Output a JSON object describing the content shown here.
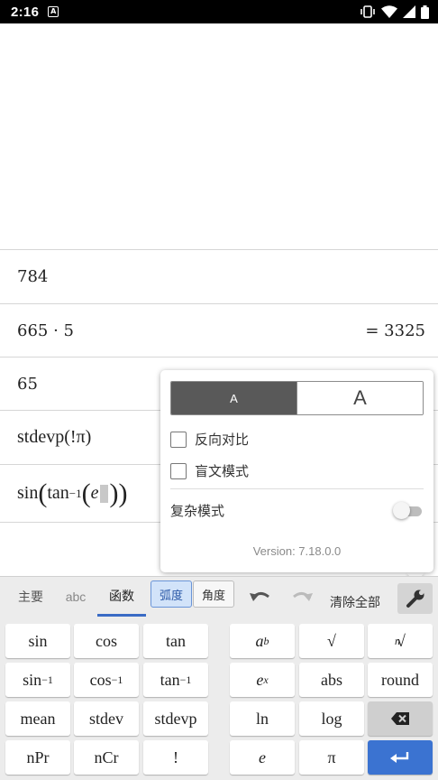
{
  "status_bar": {
    "time": "2:16",
    "notification_icon_label": "A"
  },
  "history": [
    {
      "input": "784",
      "result": ""
    },
    {
      "input": "665 · 5",
      "result": "= 3325"
    },
    {
      "input": "65",
      "result": ""
    },
    {
      "input": "stdevp(!π)",
      "result": ""
    }
  ],
  "current_input": {
    "fn1": "sin",
    "fn2": "tan",
    "fn2_sup": "−1",
    "var": "e"
  },
  "settings_popup": {
    "font_small_label": "A",
    "font_large_label": "A",
    "high_contrast_label": "反向对比",
    "braille_mode_label": "盲文模式",
    "complex_mode_label": "复杂模式",
    "complex_mode_on": false,
    "version": "Version: 7.18.0.0"
  },
  "keyboard_toolbar": {
    "tabs": [
      "主要",
      "abc",
      "函数"
    ],
    "active_tab": "函数",
    "angle_modes": [
      "弧度",
      "角度"
    ],
    "active_angle_mode": "弧度",
    "clear_all": "清除全部"
  },
  "keys": {
    "sin": "sin",
    "cos": "cos",
    "tan": "tan",
    "asin_base": "sin",
    "acos_base": "cos",
    "atan_base": "tan",
    "inverse_sup": "−1",
    "mean": "mean",
    "stdev": "stdev",
    "stdevp": "stdevp",
    "npr": "nPr",
    "ncr": "nCr",
    "factorial": "!",
    "power_base": "a",
    "power_exp": "b",
    "sqrt": "√",
    "nroot_index": "n",
    "nroot_symbol": "√",
    "exp_base": "e",
    "exp_exp": "x",
    "abs": "abs",
    "round": "round",
    "ln": "ln",
    "log": "log",
    "euler": "e",
    "pi": "π"
  },
  "colors": {
    "accent_blue": "#3b73d1",
    "active_mode_bg": "#d2e3f9",
    "font_toggle_selected": "#595959",
    "keyboard_bg": "#ececec"
  }
}
